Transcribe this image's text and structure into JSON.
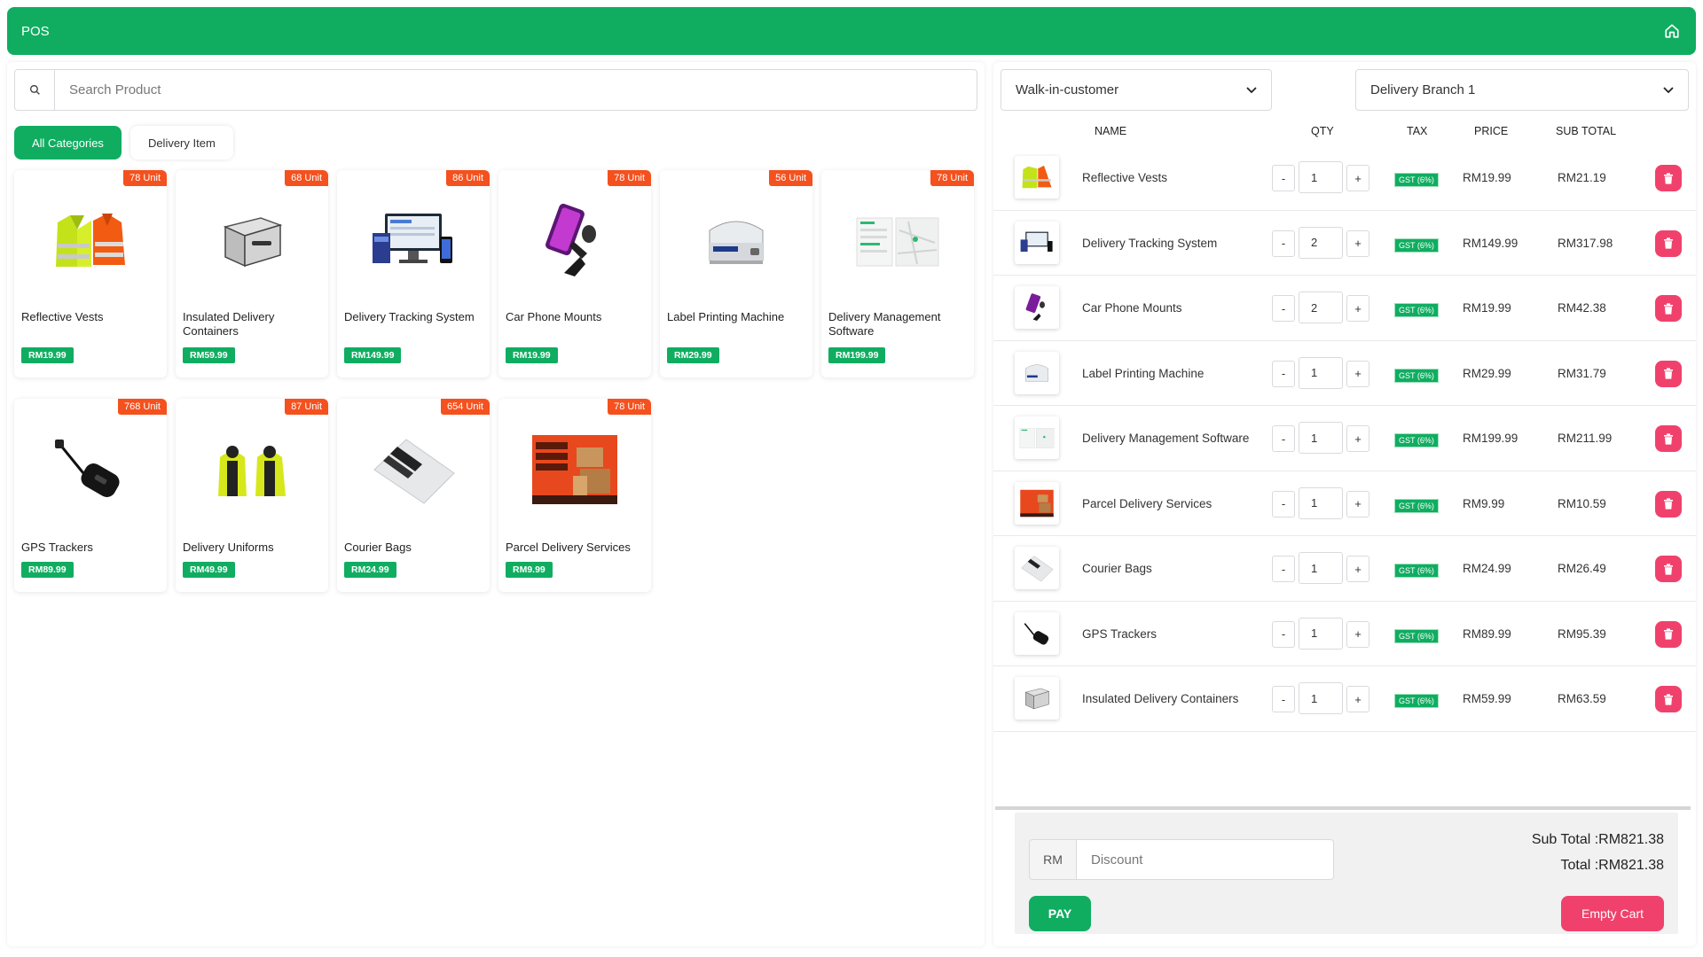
{
  "header": {
    "title": "POS",
    "home_icon": "home-icon"
  },
  "search": {
    "placeholder": "Search Product",
    "icon": "search-icon"
  },
  "categories": [
    {
      "label": "All Categories",
      "active": true
    },
    {
      "label": "Delivery Item",
      "active": false
    }
  ],
  "products": [
    {
      "name": "Reflective Vests",
      "price": "RM19.99",
      "stock": "78 Unit",
      "image": "reflective-vests-image"
    },
    {
      "name": "Insulated Delivery Containers",
      "price": "RM59.99",
      "stock": "68 Unit",
      "image": "insulated-container-image"
    },
    {
      "name": "Delivery Tracking System",
      "price": "RM149.99",
      "stock": "86 Unit",
      "image": "tracking-system-image"
    },
    {
      "name": "Car Phone Mounts",
      "price": "RM19.99",
      "stock": "78 Unit",
      "image": "phone-mount-image"
    },
    {
      "name": "Label Printing Machine",
      "price": "RM29.99",
      "stock": "56 Unit",
      "image": "label-printer-image"
    },
    {
      "name": "Delivery Management Software",
      "price": "RM199.99",
      "stock": "78 Unit",
      "image": "management-software-image"
    },
    {
      "name": "GPS Trackers",
      "price": "RM89.99",
      "stock": "768 Unit",
      "image": "gps-tracker-image"
    },
    {
      "name": "Delivery Uniforms",
      "price": "RM49.99",
      "stock": "87 Unit",
      "image": "uniforms-image"
    },
    {
      "name": "Courier Bags",
      "price": "RM24.99",
      "stock": "654 Unit",
      "image": "courier-bags-image"
    },
    {
      "name": "Parcel Delivery Services",
      "price": "RM9.99",
      "stock": "78 Unit",
      "image": "parcel-services-image"
    }
  ],
  "customer_select": {
    "value": "Walk-in-customer"
  },
  "branch_select": {
    "value": "Delivery Branch 1"
  },
  "cart": {
    "columns": {
      "name": "NAME",
      "qty": "QTY",
      "tax": "TAX",
      "price": "PRICE",
      "subtotal": "SUB TOTAL"
    },
    "minus_label": "-",
    "plus_label": "+",
    "items": [
      {
        "name": "Reflective Vests",
        "qty": "1",
        "tax": "GST (6%)",
        "price": "RM19.99",
        "subtotal": "RM21.19"
      },
      {
        "name": "Delivery Tracking System",
        "qty": "2",
        "tax": "GST (6%)",
        "price": "RM149.99",
        "subtotal": "RM317.98"
      },
      {
        "name": "Car Phone Mounts",
        "qty": "2",
        "tax": "GST (6%)",
        "price": "RM19.99",
        "subtotal": "RM42.38"
      },
      {
        "name": "Label Printing Machine",
        "qty": "1",
        "tax": "GST (6%)",
        "price": "RM29.99",
        "subtotal": "RM31.79"
      },
      {
        "name": "Delivery Management Software",
        "qty": "1",
        "tax": "GST (6%)",
        "price": "RM199.99",
        "subtotal": "RM211.99"
      },
      {
        "name": "Parcel Delivery Services",
        "qty": "1",
        "tax": "GST (6%)",
        "price": "RM9.99",
        "subtotal": "RM10.59"
      },
      {
        "name": "Courier Bags",
        "qty": "1",
        "tax": "GST (6%)",
        "price": "RM24.99",
        "subtotal": "RM26.49"
      },
      {
        "name": "GPS Trackers",
        "qty": "1",
        "tax": "GST (6%)",
        "price": "RM89.99",
        "subtotal": "RM95.39"
      },
      {
        "name": "Insulated Delivery Containers",
        "qty": "1",
        "tax": "GST (6%)",
        "price": "RM59.99",
        "subtotal": "RM63.59"
      }
    ]
  },
  "summary": {
    "currency": "RM",
    "discount_placeholder": "Discount",
    "subtotal": "Sub Total :RM821.38",
    "total": "Total :RM821.38",
    "pay_label": "PAY",
    "empty_label": "Empty Cart"
  },
  "colors": {
    "primary": "#10ad61",
    "stock_badge": "#f4511e",
    "danger": "#f0416c"
  }
}
